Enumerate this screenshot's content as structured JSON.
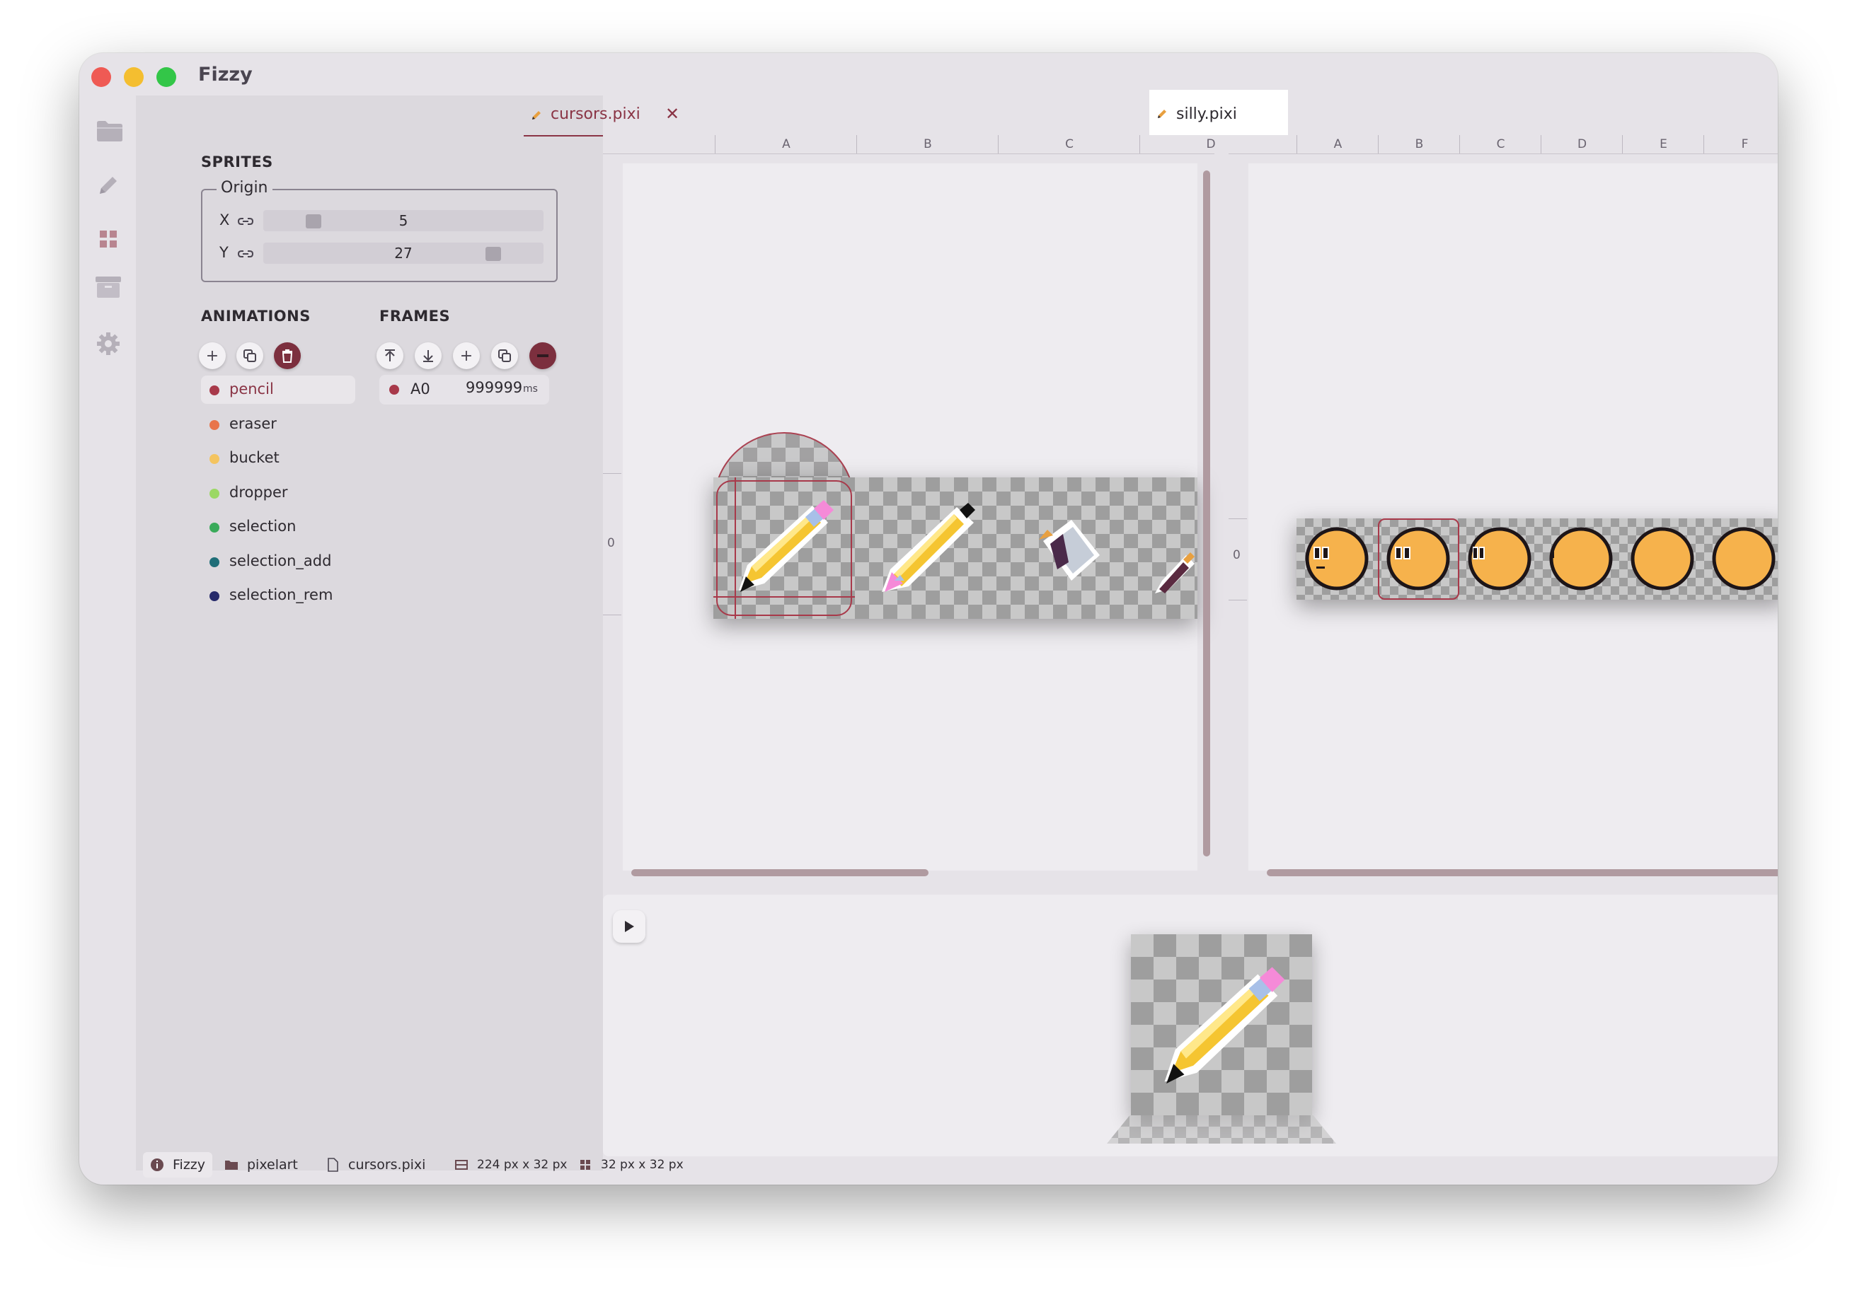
{
  "window": {
    "title": "Fizzy"
  },
  "iconbar": [
    "folder-icon",
    "pencil-icon",
    "grid-icon",
    "archive-icon",
    "gear-icon"
  ],
  "sprites": {
    "heading": "SPRITES",
    "origin_label": "Origin",
    "x_label": "X",
    "x_value": "5",
    "y_label": "Y",
    "y_value": "27"
  },
  "animations": {
    "heading": "ANIMATIONS",
    "items": [
      {
        "label": "pencil",
        "color": "#a8394a"
      },
      {
        "label": "eraser",
        "color": "#e8744a"
      },
      {
        "label": "bucket",
        "color": "#f4c460"
      },
      {
        "label": "dropper",
        "color": "#9bd864"
      },
      {
        "label": "selection",
        "color": "#3aaa5a"
      },
      {
        "label": "selection_add",
        "color": "#1f6e78"
      },
      {
        "label": "selection_rem",
        "color": "#262a6a"
      }
    ],
    "selected": "pencil"
  },
  "frames": {
    "heading": "FRAMES",
    "items": [
      {
        "label": "A0",
        "duration": "999999",
        "unit": "ms",
        "color": "#a8394a"
      }
    ]
  },
  "tabs": {
    "left": {
      "label": "cursors.pixi",
      "close": "✕"
    },
    "right": {
      "label": "silly.pixi"
    }
  },
  "left_canvas": {
    "columns": [
      "A",
      "B",
      "C",
      "D"
    ],
    "row_label": "0"
  },
  "right_canvas": {
    "columns": [
      "A",
      "B",
      "C",
      "D",
      "E",
      "F"
    ],
    "row_label": "0"
  },
  "preview": {
    "play_icon": "play-icon"
  },
  "statusbar": {
    "app": "Fizzy",
    "folder": "pixelart",
    "file": "cursors.pixi",
    "image_size": "224 px x 32 px",
    "tile_size": "32 px x 32 px"
  },
  "colors": {
    "accent": "#7c2f3e",
    "panel": "#dcd9de",
    "canvas": "#eeecf0"
  }
}
